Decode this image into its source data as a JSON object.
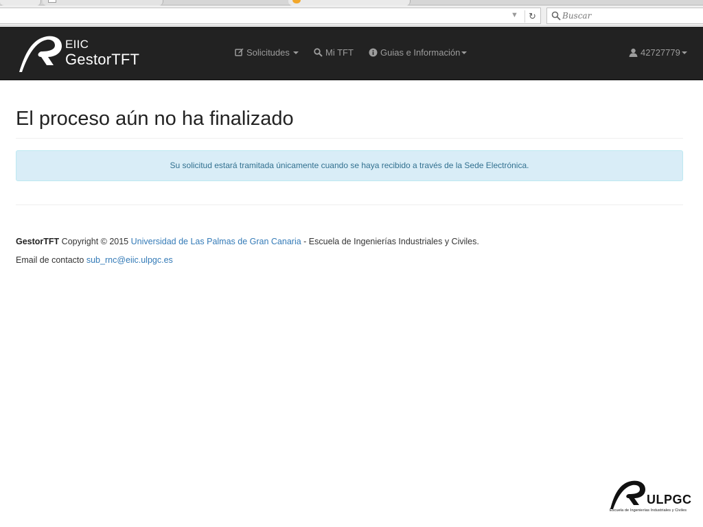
{
  "browser": {
    "search_placeholder": "Buscar",
    "reload_glyph": "↻",
    "dropdown_glyph": "▼"
  },
  "navbar": {
    "brand_line1": "EIIC",
    "brand_line2": "GestorTFT",
    "items": [
      {
        "label": "Solicitudes",
        "icon": "edit-icon",
        "has_caret": true
      },
      {
        "label": "Mi TFT",
        "icon": "search-icon",
        "has_caret": false
      },
      {
        "label": "Guias e Información",
        "icon": "info-icon",
        "has_caret": true
      }
    ],
    "user": {
      "label": "42727779",
      "icon": "user-icon",
      "has_caret": true
    },
    "background": "#222222",
    "link_color": "#9d9d9d"
  },
  "main": {
    "title": "El proceso aún no ha finalizado",
    "alert": "Su solicitud estará tramitada únicamente cuando se haya recibido a través de la Sede Electrónica.",
    "alert_bg": "#d9edf7",
    "alert_color": "#31708f"
  },
  "footer": {
    "brand": "GestorTFT",
    "copyright": " Copyright © 2015 ",
    "university_link": "Universidad de Las Palmas de Gran Canaria",
    "school_text": " - Escuela de Ingenierías Industriales y Civiles.",
    "email_label": "Email de contacto ",
    "email_link": "sub_rnc@eiic.ulpgc.es",
    "link_color": "#337ab7"
  },
  "ulpgc_logo": {
    "name": "ULPGC",
    "subtitle": "Escuela de Ingenierías Industriales y Civiles"
  }
}
